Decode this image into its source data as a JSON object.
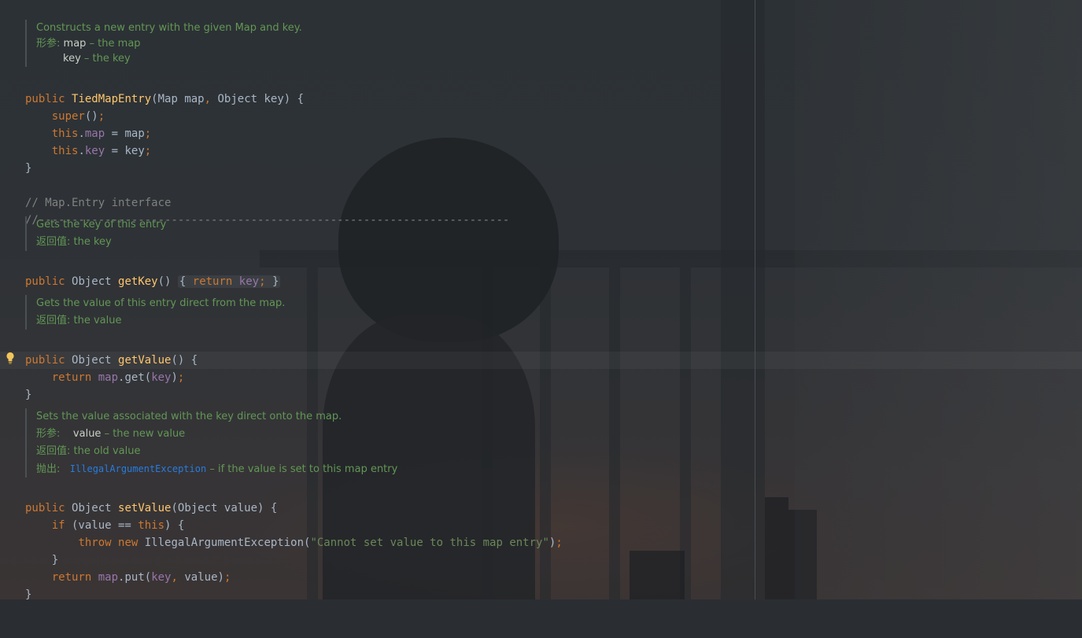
{
  "doc_constructor": {
    "summary": "Constructs a new entry with the given Map and key.",
    "params_tag": "形参:",
    "p1_name": "map",
    "p1_desc": " – the map",
    "p2_name": "key",
    "p2_desc": " – the key"
  },
  "constructor": {
    "kw_public": "public ",
    "name": "TiedMapEntry",
    "sig_open": "(Map map",
    "comma": ",",
    "sig_rest": " Object key) {",
    "super_kw": "super",
    "super_tail": "()",
    "semi": ";",
    "this_kw": "this",
    "dot": ".",
    "f_map": "map",
    "assign_map": " = map",
    "f_key": "key",
    "assign_key": " = key",
    "close": "}"
  },
  "section_comment": {
    "line1": "// Map.Entry interface",
    "line2": "//-----------------------------------------------------------------------"
  },
  "doc_getkey": {
    "summary": "Gets the key of this entry",
    "return_tag": "返回值:",
    "return_desc": " the key"
  },
  "getkey": {
    "kw_public": "public ",
    "type": "Object ",
    "name": "getKey",
    "parens": "() ",
    "fold_open": "{ ",
    "return_kw": "return ",
    "field": "key",
    "semi": ";",
    "fold_close": " }"
  },
  "doc_getvalue": {
    "summary": "Gets the value of this entry direct from the map.",
    "return_tag": "返回值:",
    "return_desc": " the value"
  },
  "getvalue": {
    "kw_public": "public ",
    "type": "Object ",
    "name": "getValue",
    "tail": "() {",
    "return_kw": "return ",
    "field": "map",
    "call": ".get(",
    "arg": "key",
    "call_close": ")",
    "semi": ";",
    "close": "}"
  },
  "doc_setvalue": {
    "summary": "Sets the value associated with the key direct onto the map.",
    "params_tag": "形参:",
    "p1_name": "value",
    "p1_desc": " – the new value",
    "return_tag": "返回值:",
    "return_desc": " the old value",
    "throws_tag": "抛出:",
    "exception": "IllegalArgumentException",
    "throws_desc": " – if the value is set to this map entry"
  },
  "setvalue": {
    "kw_public": "public ",
    "type": "Object ",
    "name": "setValue",
    "sig": "(Object value) {",
    "if_kw": "if",
    "cond_open": " (value == ",
    "this_kw": "this",
    "cond_close": ") {",
    "throw_kw": "throw ",
    "new_kw": "new ",
    "exc": "IllegalArgumentException(",
    "msg": "\"Cannot set value to this map entry\"",
    "exc_close": ")",
    "semi": ";",
    "inner_close": "}",
    "return_kw": "return ",
    "field": "map",
    "put": ".put(",
    "arg1": "key",
    "comma": ",",
    "arg2": " value)",
    "close": "}"
  }
}
